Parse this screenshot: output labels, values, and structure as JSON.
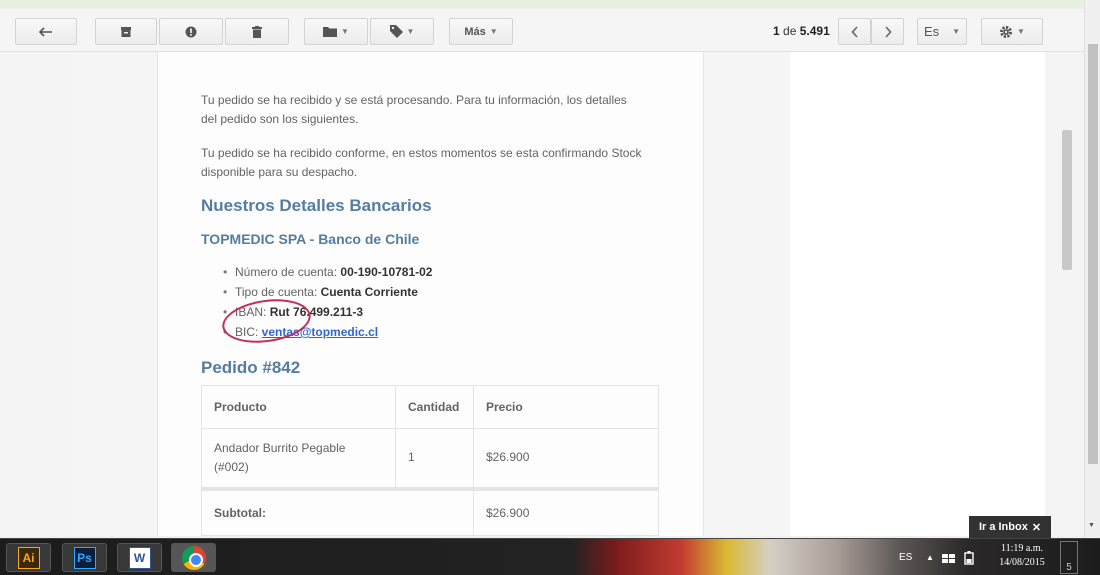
{
  "toolbar": {
    "back_icon": "reply-arrow-icon",
    "archive_icon": "archive-icon",
    "spam_icon": "report-spam-icon",
    "delete_icon": "trash-icon",
    "move_icon": "folder-icon",
    "labels_icon": "tag-icon",
    "more_label": "Más",
    "count_current": "1",
    "count_sep": "de",
    "count_total": "5.491",
    "prev_icon": "chevron-left-icon",
    "next_icon": "chevron-right-icon",
    "lang_label": "Es",
    "settings_icon": "gear-icon"
  },
  "email": {
    "intro_1": "Tu pedido se ha recibido y se está procesando. Para tu información, los detalles del pedido son los siguientes.",
    "intro_2": "Tu pedido se ha recibido conforme, en estos momentos se esta confirmando Stock disponible para su despacho.",
    "bank_heading": "Nuestros Detalles Bancarios",
    "bank_name": "TOPMEDIC SPA - Banco de Chile",
    "bank_items": [
      {
        "label": "Número de cuenta: ",
        "value": "00-190-10781-02"
      },
      {
        "label": "Tipo de cuenta: ",
        "value": "Cuenta Corriente"
      },
      {
        "label": "IBAN: ",
        "value": "Rut 76.499.211-3"
      },
      {
        "label": "BIC: ",
        "value": "ventas@topmedic.cl"
      }
    ],
    "order_heading": "Pedido #842",
    "table": {
      "headers": [
        "Producto",
        "Cantidad",
        "Precio"
      ],
      "rows": [
        {
          "product": "Andador Burrito Pegable (#002)",
          "qty": "1",
          "price": "$26.900"
        }
      ],
      "subtotal_label": "Subtotal:",
      "subtotal_value": "$26.900"
    },
    "annotation_color": "#c62b5a"
  },
  "overlay": {
    "goto_inbox_label": "Ir a Inbox",
    "close_icon": "close-icon"
  },
  "taskbar": {
    "apps": [
      {
        "name": "Ai",
        "icon": "illustrator-icon"
      },
      {
        "name": "Ps",
        "icon": "photoshop-icon"
      },
      {
        "name": "W",
        "icon": "word-icon"
      },
      {
        "name": "",
        "icon": "chrome-icon"
      }
    ],
    "lang": "ES",
    "tray_icons": [
      "up-arrow-icon",
      "network-icon",
      "battery-icon"
    ],
    "time": "11:19 a.m.",
    "date": "14/08/2015",
    "show_desktop": "5"
  }
}
